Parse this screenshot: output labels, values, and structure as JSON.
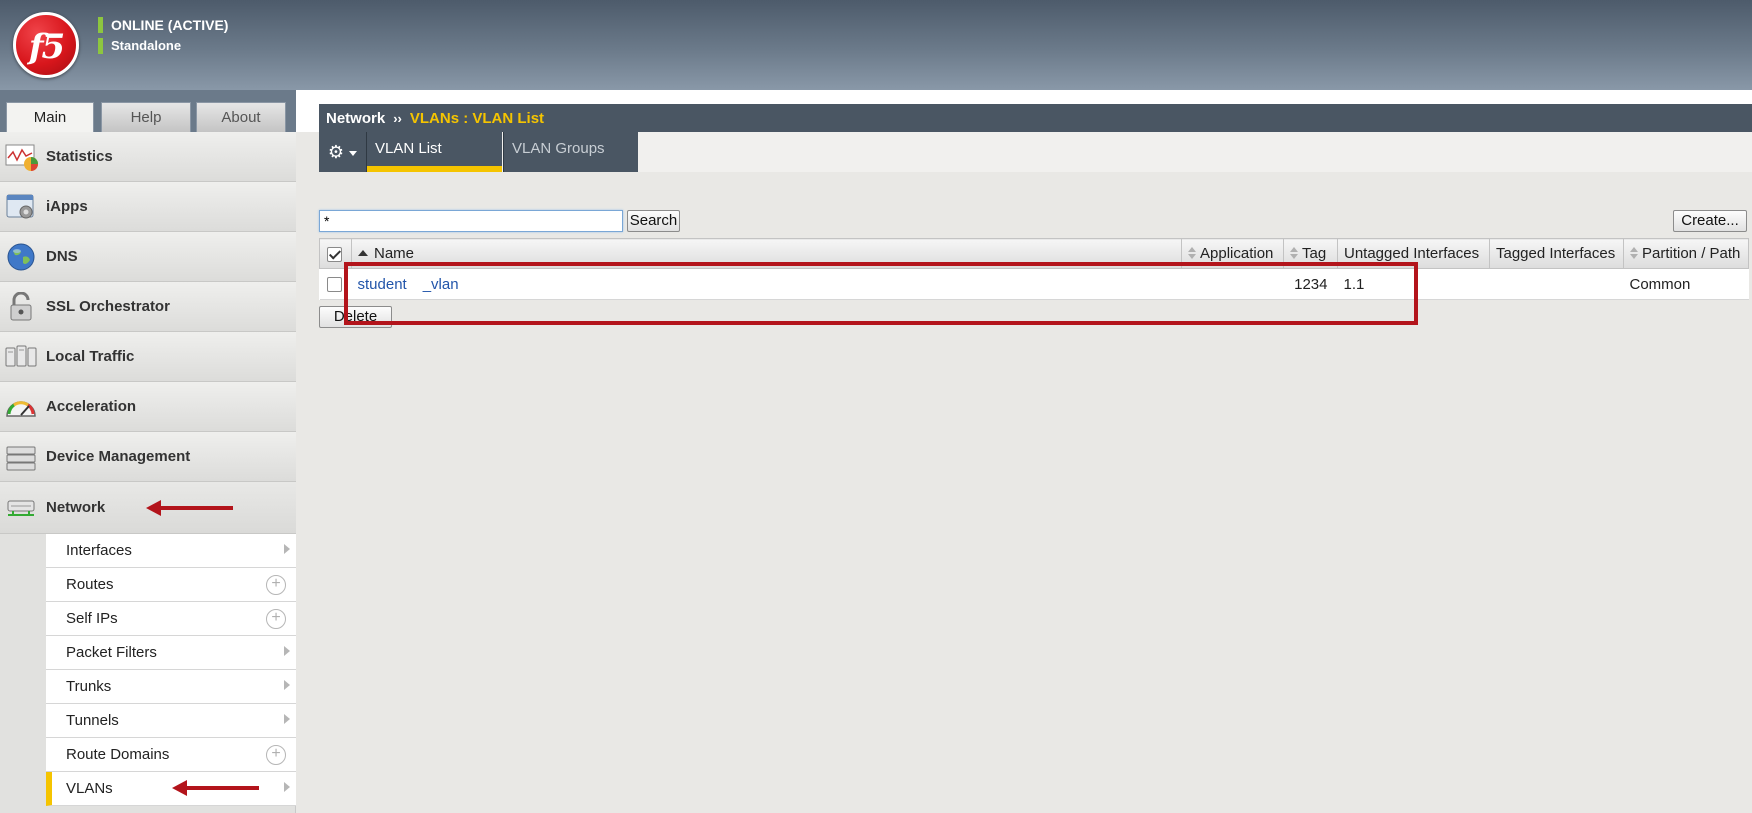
{
  "header": {
    "logo_text": "f5",
    "status": "ONLINE (ACTIVE)",
    "mode": "Standalone"
  },
  "left_tabs": [
    {
      "label": "Main",
      "active": true
    },
    {
      "label": "Help",
      "active": false
    },
    {
      "label": "About",
      "active": false
    }
  ],
  "sidebar": {
    "items": [
      {
        "label": "Statistics",
        "icon": "statistics-icon"
      },
      {
        "label": "iApps",
        "icon": "iapps-icon"
      },
      {
        "label": "DNS",
        "icon": "globe-icon"
      },
      {
        "label": "SSL Orchestrator",
        "icon": "lock-icon"
      },
      {
        "label": "Local Traffic",
        "icon": "local-traffic-icon"
      },
      {
        "label": "Acceleration",
        "icon": "gauge-icon"
      },
      {
        "label": "Device Management",
        "icon": "device-icon"
      },
      {
        "label": "Network",
        "icon": "network-icon",
        "active": true
      }
    ],
    "network_sub": [
      {
        "label": "Interfaces",
        "control": "chevron"
      },
      {
        "label": "Routes",
        "control": "plus"
      },
      {
        "label": "Self IPs",
        "control": "plus"
      },
      {
        "label": "Packet Filters",
        "control": "chevron"
      },
      {
        "label": "Trunks",
        "control": "chevron"
      },
      {
        "label": "Tunnels",
        "control": "chevron"
      },
      {
        "label": "Route Domains",
        "control": "plus"
      },
      {
        "label": "VLANs",
        "control": "chevron",
        "selected": true
      }
    ]
  },
  "breadcrumb": {
    "section": "Network",
    "separator": "››",
    "current": "VLANs : VLAN List"
  },
  "subtabs": [
    {
      "label": "VLAN List",
      "active": true
    },
    {
      "label": "VLAN Groups",
      "active": false
    }
  ],
  "search": {
    "value": "*",
    "button_label": "Search"
  },
  "create_label": "Create...",
  "delete_label": "Delete",
  "table": {
    "columns": [
      "Name",
      "Application",
      "Tag",
      "Untagged Interfaces",
      "Tagged Interfaces",
      "Partition / Path"
    ],
    "rows": [
      {
        "name_part1": "student",
        "name_part2": "_vlan",
        "application": "",
        "tag": "1234",
        "untagged": "1.1",
        "tagged": "",
        "partition": "Common"
      }
    ]
  },
  "colors": {
    "accent_yellow": "#f5c400",
    "annotation_red": "#b3141b",
    "header_dark": "#4a5663",
    "status_green": "#8dc63f"
  }
}
